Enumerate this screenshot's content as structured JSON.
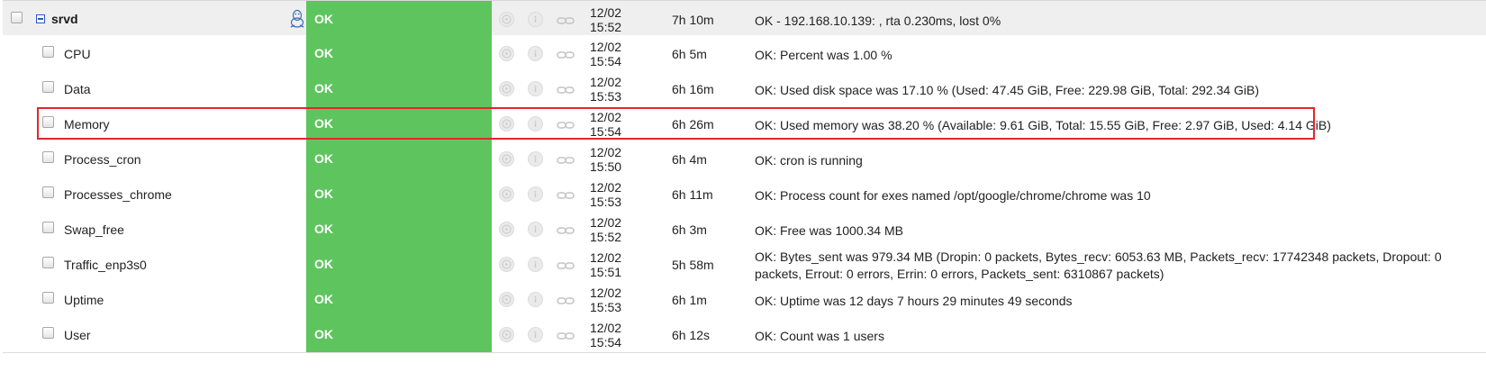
{
  "host": {
    "name": "srvd",
    "os_icon": "linux-tux-icon",
    "status": "OK",
    "date_line1": "12/02",
    "date_line2": "15:52",
    "duration": "7h 10m",
    "info": "OK - 192.168.10.139: , rta 0.230ms, lost 0%"
  },
  "services": [
    {
      "name": "CPU",
      "status": "OK",
      "date_line1": "12/02",
      "date_line2": "15:54",
      "duration": "6h 5m",
      "info": "OK: Percent was 1.00 %"
    },
    {
      "name": "Data",
      "status": "OK",
      "date_line1": "12/02",
      "date_line2": "15:53",
      "duration": "6h 16m",
      "info": "OK: Used disk space was 17.10 % (Used: 47.45 GiB, Free: 229.98 GiB, Total: 292.34 GiB)"
    },
    {
      "name": "Memory",
      "status": "OK",
      "date_line1": "12/02",
      "date_line2": "15:54",
      "duration": "6h 26m",
      "info": "OK: Used memory was 38.20 % (Available: 9.61 GiB, Total: 15.55 GiB, Free: 2.97 GiB, Used: 4.14 GiB)"
    },
    {
      "name": "Process_cron",
      "status": "OK",
      "date_line1": "12/02",
      "date_line2": "15:50",
      "duration": "6h 4m",
      "info": "OK: cron is running"
    },
    {
      "name": "Processes_chrome",
      "status": "OK",
      "date_line1": "12/02",
      "date_line2": "15:53",
      "duration": "6h 11m",
      "info": "OK: Process count for exes named /opt/google/chrome/chrome was 10"
    },
    {
      "name": "Swap_free",
      "status": "OK",
      "date_line1": "12/02",
      "date_line2": "15:52",
      "duration": "6h 3m",
      "info": "OK: Free was 1000.34 MB"
    },
    {
      "name": "Traffic_enp3s0",
      "status": "OK",
      "date_line1": "12/02",
      "date_line2": "15:51",
      "duration": "5h 58m",
      "info": "OK: Bytes_sent was 979.34 MB (Dropin: 0 packets, Bytes_recv: 6053.63 MB, Packets_recv: 17742348 packets, Dropout: 0 packets, Errout: 0 errors, Errin: 0 errors, Packets_sent: 6310867 packets)"
    },
    {
      "name": "Uptime",
      "status": "OK",
      "date_line1": "12/02",
      "date_line2": "15:53",
      "duration": "6h 1m",
      "info": "OK: Uptime was 12 days 7 hours 29 minutes 49 seconds"
    },
    {
      "name": "User",
      "status": "OK",
      "date_line1": "12/02",
      "date_line2": "15:54",
      "duration": "6h 12s",
      "info": "OK: Count was 1 users"
    }
  ],
  "colors": {
    "status_ok": "#5ec55e",
    "highlight": "#e3262b",
    "host_row_bg": "#efefef"
  },
  "action_icons": [
    "schedule-check-icon",
    "info-icon",
    "link-icon"
  ],
  "highlighted_row": "Memory"
}
